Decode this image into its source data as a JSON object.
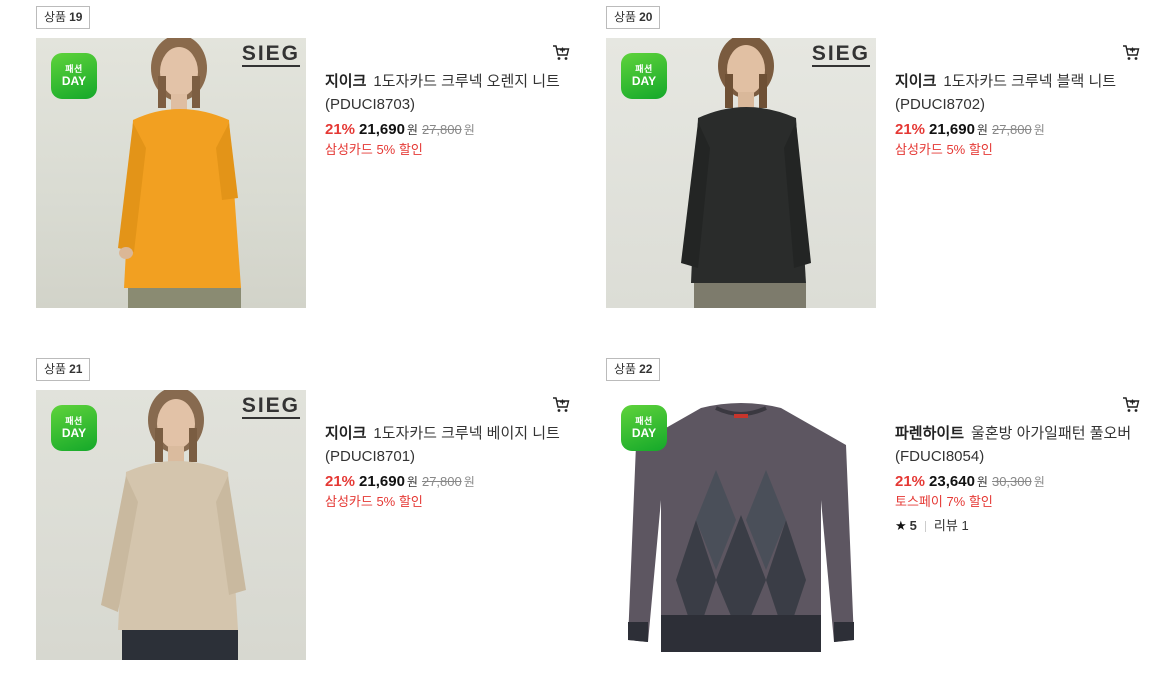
{
  "colors": {
    "discount": "#e53935",
    "day_badge": "#2fbf31",
    "sweater_orange": "#f2a021",
    "sweater_black": "#2a2c2b",
    "sweater_beige": "#d4c5ad",
    "sweater_argyle": "#5d5661"
  },
  "products": [
    {
      "badge_label": "상품",
      "badge_number": "19",
      "day_badge": [
        "패션",
        "DAY"
      ],
      "brand_logo": "SIEG",
      "brand": "지이크",
      "name": "1도자카드 크루넥 오렌지 니트 (PDUCI8703)",
      "discount": "21%",
      "price": "21,690",
      "currency": "원",
      "original_price": "27,800",
      "original_currency": "원",
      "promo": "삼성카드 5% 할인",
      "icon": "cart-icon"
    },
    {
      "badge_label": "상품",
      "badge_number": "20",
      "day_badge": [
        "패션",
        "DAY"
      ],
      "brand_logo": "SIEG",
      "brand": "지이크",
      "name": "1도자카드 크루넥 블랙 니트 (PDUCI8702)",
      "discount": "21%",
      "price": "21,690",
      "currency": "원",
      "original_price": "27,800",
      "original_currency": "원",
      "promo": "삼성카드 5% 할인",
      "icon": "cart-icon"
    },
    {
      "badge_label": "상품",
      "badge_number": "21",
      "day_badge": [
        "패션",
        "DAY"
      ],
      "brand_logo": "SIEG",
      "brand": "지이크",
      "name": "1도자카드 크루넥 베이지 니트 (PDUCI8701)",
      "discount": "21%",
      "price": "21,690",
      "currency": "원",
      "original_price": "27,800",
      "original_currency": "원",
      "promo": "삼성카드 5% 할인",
      "icon": "cart-icon"
    },
    {
      "badge_label": "상품",
      "badge_number": "22",
      "day_badge": [
        "패션",
        "DAY"
      ],
      "brand": "파렌하이트",
      "name": "울혼방 아가일패턴 풀오버 (FDUCI8054)",
      "discount": "21%",
      "price": "23,640",
      "currency": "원",
      "original_price": "30,300",
      "original_currency": "원",
      "promo": "토스페이 7% 할인",
      "rating": "5",
      "review_label": "리뷰",
      "review_count": "1",
      "icon": "cart-icon"
    }
  ]
}
